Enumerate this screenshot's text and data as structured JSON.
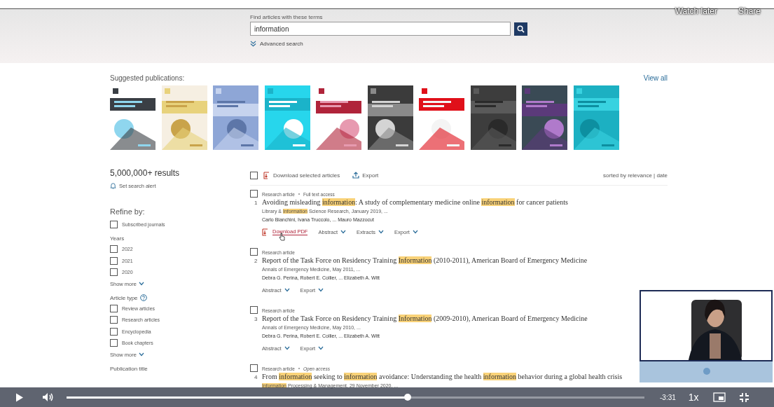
{
  "player": {
    "watch_later": "Watch later",
    "share": "Share",
    "level": 0.59,
    "time": "-3:31",
    "speed": "1x"
  },
  "search": {
    "label": "Find articles with these terms",
    "value": "information",
    "advanced": "Advanced search"
  },
  "suggested": {
    "heading": "Suggested publications:",
    "view_all": "View all"
  },
  "sidebar": {
    "results": "5,000,000+ results",
    "alert": "Set search alert",
    "refine": "Refine by:",
    "groups": [
      {
        "options": [
          {
            "label": "Subscribed journals",
            "checked": false
          }
        ]
      },
      {
        "heading": "Years",
        "options": [
          {
            "label": "2022",
            "checked": false
          },
          {
            "label": "2021",
            "checked": false
          },
          {
            "label": "2020",
            "checked": false
          }
        ],
        "more": "Show more"
      },
      {
        "heading": "Article type",
        "help": true,
        "options": [
          {
            "label": "Review articles",
            "checked": false
          },
          {
            "label": "Research articles",
            "checked": false
          },
          {
            "label": "Encyclopedia",
            "checked": false
          },
          {
            "label": "Book chapters",
            "checked": false
          }
        ],
        "more": "Show more"
      },
      {
        "heading": "Publication title"
      }
    ]
  },
  "toolbar": {
    "checked": false,
    "download": "Download selected articles",
    "export": "Export",
    "sort": "sorted by relevance | date"
  },
  "articles": [
    {
      "checked": false,
      "type": "Research article",
      "access": "Full text access",
      "number": "1",
      "title": "Avoiding misleading **information**: A study of complementary medicine online **information** for cancer patients",
      "source": "Library & **Information** Science Research, January 2019, ...",
      "authors": "Carlo Bianchini, Ivana Truccolo, ... Mauro Mazzocut",
      "actions": [
        {
          "kind": "pdf",
          "label": "Download PDF"
        },
        {
          "kind": "dropdown",
          "label": "Abstract"
        },
        {
          "kind": "dropdown",
          "label": "Extracts"
        },
        {
          "kind": "dropdown",
          "label": "Export"
        }
      ]
    },
    {
      "checked": false,
      "type": "Research article",
      "number": "2",
      "title": "Report of the Task Force on Residency Training **Information** (2010-2011), American Board of Emergency Medicine",
      "source": "Annals of Emergency Medicine, May 2011, ...",
      "authors": "Debra G. Perina, Robert E. Collier, ... Elizabeth A. Witt",
      "actions": [
        {
          "kind": "dropdown",
          "label": "Abstract"
        },
        {
          "kind": "dropdown",
          "label": "Export"
        }
      ]
    },
    {
      "checked": false,
      "type": "Research article",
      "number": "3",
      "title": "Report of the Task Force on Residency Training **Information** (2009-2010), American Board of Emergency Medicine",
      "source": "Annals of Emergency Medicine, May 2010, ...",
      "authors": "Debra G. Perina, Robert E. Collier, ... Elizabeth A. Witt",
      "actions": [
        {
          "kind": "dropdown",
          "label": "Abstract"
        },
        {
          "kind": "dropdown",
          "label": "Export"
        }
      ]
    },
    {
      "checked": false,
      "type": "Research article",
      "access": "Open access",
      "number": "4",
      "title": "From **information** seeking to **information** avoidance: Understanding the health **information** behavior during a global health crisis",
      "source": "**Information** Processing & Management, 29 November 2020, ..."
    }
  ]
}
